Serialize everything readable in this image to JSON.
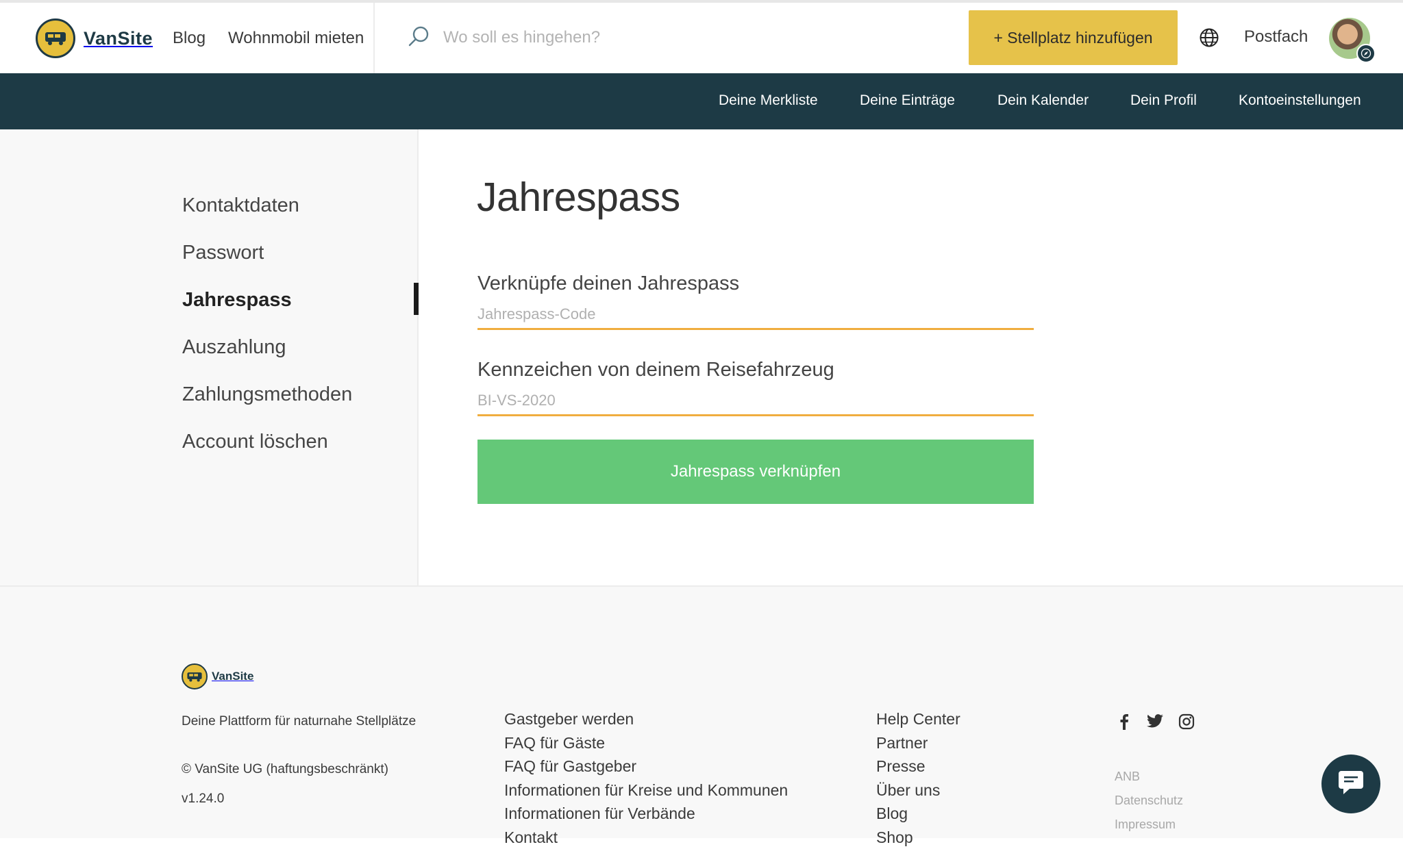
{
  "header": {
    "logo_text": "VanSite",
    "nav": {
      "blog": "Blog",
      "rent": "Wohnmobil mieten"
    },
    "search": {
      "placeholder": "Wo soll es hingehen?"
    },
    "add_button": "+ Stellplatz hinzufügen",
    "postfach": "Postfach"
  },
  "subnav": {
    "items": [
      "Deine Merkliste",
      "Deine Einträge",
      "Dein Kalender",
      "Dein Profil",
      "Kontoeinstellungen"
    ]
  },
  "sidebar": {
    "items": [
      "Kontaktdaten",
      "Passwort",
      "Jahrespass",
      "Auszahlung",
      "Zahlungsmethoden",
      "Account löschen"
    ],
    "active": "Jahrespass"
  },
  "main": {
    "title": "Jahrespass",
    "code_label": "Verknüpfe deinen Jahrespass",
    "code_placeholder": "Jahrespass-Code",
    "plate_label": "Kennzeichen von deinem Reisefahrzeug",
    "plate_placeholder": "BI-VS-2020",
    "submit": "Jahrespass verknüpfen"
  },
  "footer": {
    "logo_text": "VanSite",
    "tagline": "Deine Plattform für naturnahe Stellplätze",
    "copyright": "© VanSite UG (haftungsbeschränkt)",
    "version": "v1.24.0",
    "col1": [
      "Gastgeber werden",
      "FAQ für Gäste",
      "FAQ für Gastgeber",
      "Informationen für Kreise und Kommunen",
      "Informationen für Verbände",
      "Kontakt"
    ],
    "col2": [
      "Help Center",
      "Partner",
      "Presse",
      "Über uns",
      "Blog",
      "Shop"
    ],
    "legal": [
      "ANB",
      "Datenschutz",
      "Impressum"
    ]
  },
  "colors": {
    "brand_dark": "#1d3a45",
    "brand_yellow": "#e6c24a",
    "accent_green": "#64c878",
    "input_underline": "#f0ad3e"
  }
}
